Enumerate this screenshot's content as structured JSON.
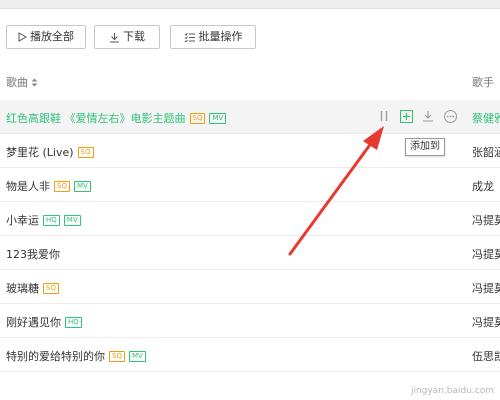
{
  "toolbar": {
    "play_all": "播放全部",
    "download": "下载",
    "batch": "批量操作"
  },
  "header": {
    "song_col": "歌曲",
    "singer_col": "歌手"
  },
  "songs": [
    {
      "title": "红色高跟鞋 《爱情左右》电影主题曲",
      "badges": [
        "SQ",
        "MV"
      ],
      "singer": "蔡健雅",
      "highlighted": true
    },
    {
      "title": "梦里花 (Live)",
      "badges": [
        "SQ"
      ],
      "singer": "张韶涵"
    },
    {
      "title": "物是人非",
      "badges": [
        "SQ",
        "MV"
      ],
      "singer": "成龙"
    },
    {
      "title": "小幸运",
      "badges": [
        "HQ",
        "MV"
      ],
      "singer": "冯提莫"
    },
    {
      "title": "123我爱你",
      "badges": [],
      "singer": "冯提莫"
    },
    {
      "title": "玻璃糖",
      "badges": [
        "SQ"
      ],
      "singer": "冯提莫"
    },
    {
      "title": "刚好遇见你",
      "badges": [
        "HQ"
      ],
      "singer": "冯提莫"
    },
    {
      "title": "特别的爱给特别的你",
      "badges": [
        "SQ",
        "MV"
      ],
      "singer": "伍思凯"
    }
  ],
  "tooltip": {
    "add_to": "添加到"
  },
  "icons": {
    "play": "play-icon",
    "download": "download-icon",
    "batch": "batch-icon",
    "sort": "sort-icon",
    "pause": "pause-icon",
    "add": "add-icon",
    "more": "more-icon"
  },
  "colors": {
    "accent_green": "#31c27c",
    "sq_orange": "#f39c12",
    "arrow_red": "#e8392e",
    "row_highlight": "#f4f4f4"
  },
  "watermark": {
    "text": "jingyan.baidu.com"
  }
}
